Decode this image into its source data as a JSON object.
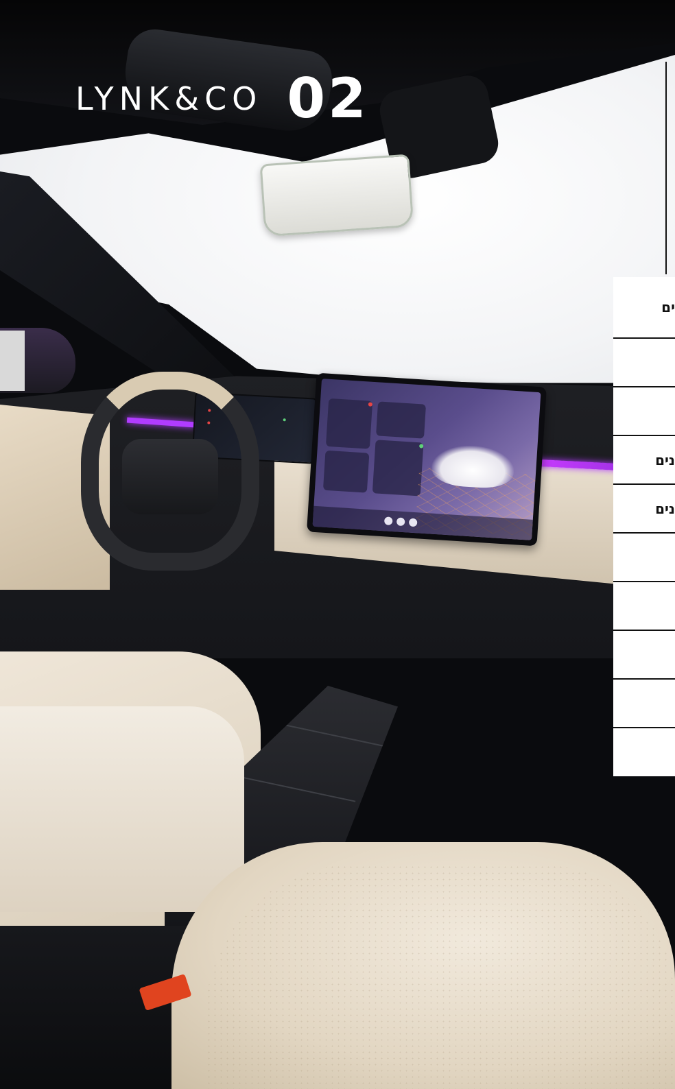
{
  "brand": {
    "logo_text": "LYNK&CO",
    "model": "02"
  },
  "spec_panel": {
    "rows": [
      {
        "label": "ים"
      },
      {
        "label": ""
      },
      {
        "label": ""
      },
      {
        "label": "נים"
      },
      {
        "label": "נים"
      },
      {
        "label": ""
      },
      {
        "label": ""
      },
      {
        "label": ""
      },
      {
        "label": ""
      },
      {
        "label": ""
      }
    ]
  },
  "colors": {
    "ambient_light": "#b13cff",
    "panel_background": "#ffffff",
    "panel_divider": "#111111",
    "seat_belt_buckle": "#e0441f"
  },
  "icons": [
    "infotainment-screen-icon",
    "steering-wheel-icon"
  ]
}
